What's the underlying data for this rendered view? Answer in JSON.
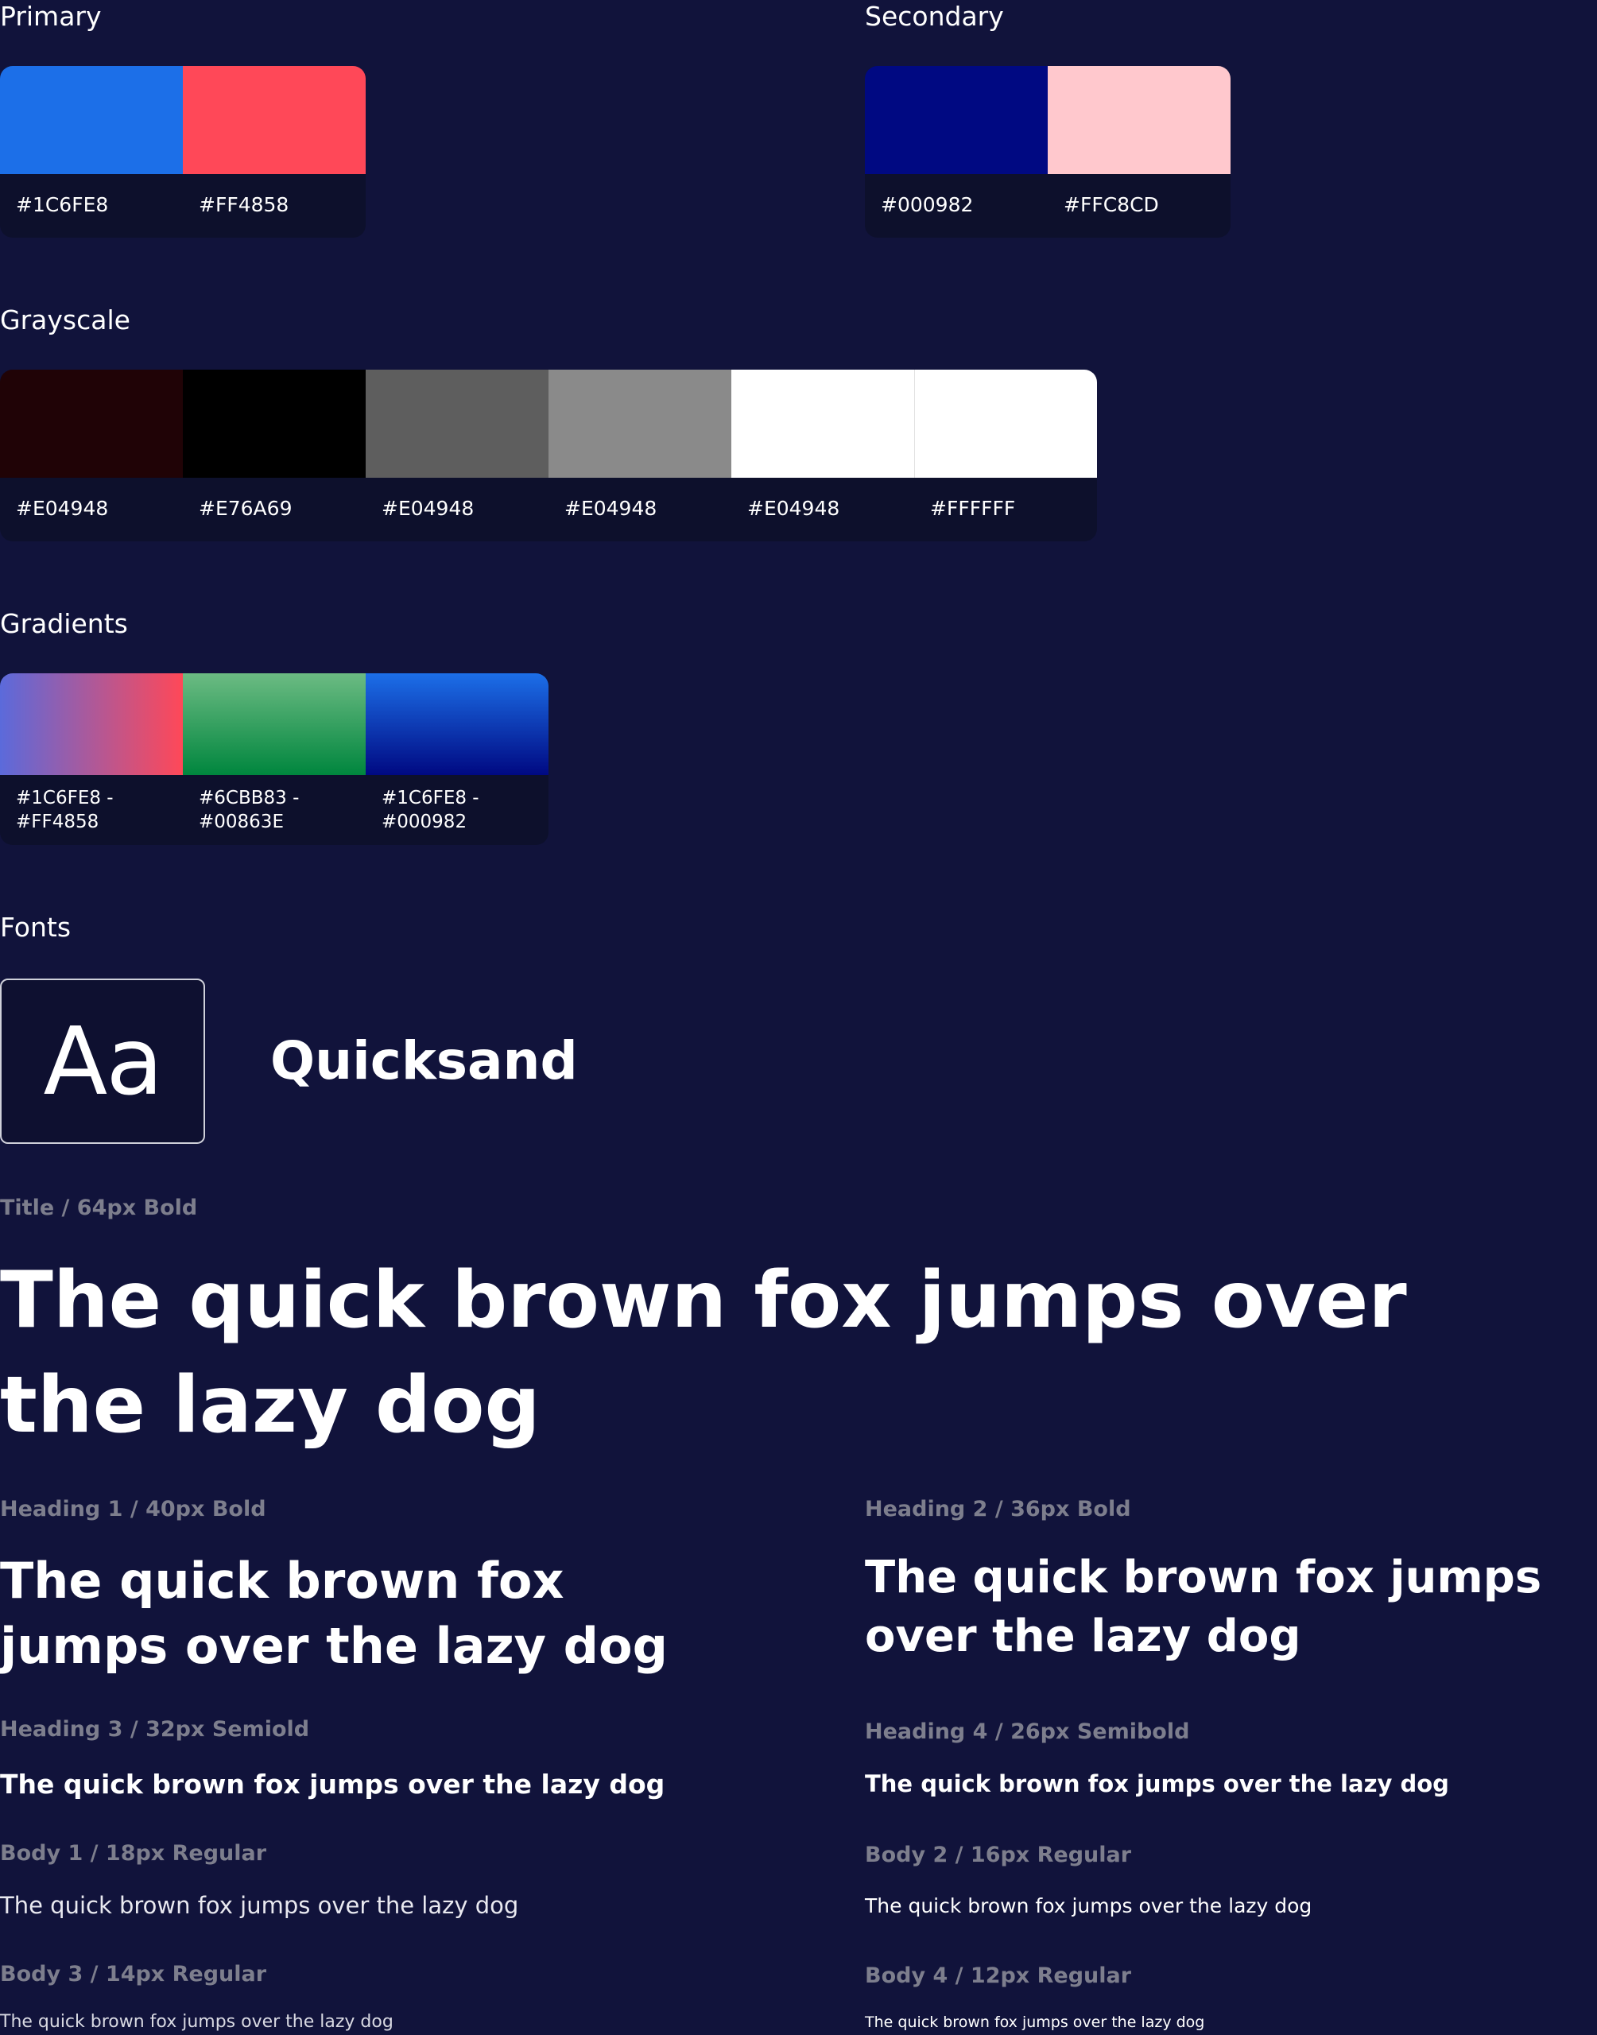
{
  "sections": {
    "primary": "Primary",
    "secondary": "Secondary",
    "grayscale": "Grayscale",
    "gradients": "Gradients",
    "fonts": "Fonts"
  },
  "colors": {
    "primary": [
      {
        "label": "#1C6FE8",
        "swatch": "#1C6FE8"
      },
      {
        "label": "#FF4858",
        "swatch": "#FF4858"
      }
    ],
    "secondary": [
      {
        "label": "#000982",
        "swatch": "#000982"
      },
      {
        "label": "#FFC8CD",
        "swatch": "#FFC8CD"
      }
    ],
    "grayscale": [
      {
        "label": "#E04948",
        "swatch": "#200306"
      },
      {
        "label": "#E76A69",
        "swatch": "#000000"
      },
      {
        "label": "#E04948",
        "swatch": "#5E5E5E"
      },
      {
        "label": "#E04948",
        "swatch": "#8A8A8A"
      },
      {
        "label": "#E04948",
        "swatch": "#FFFFFF"
      },
      {
        "label": "#FFFFFF",
        "swatch": "#FFFFFF"
      }
    ],
    "gradients": [
      {
        "label": "#1C6FE8 - #FF4858",
        "from": "#5B6ADB",
        "to": "#FF4858",
        "direction": "to right"
      },
      {
        "label": "#6CBB83 - #00863E",
        "from": "#6CBB83",
        "to": "#00863E",
        "direction": "to bottom"
      },
      {
        "label": "#1C6FE8 - #000982",
        "from": "#1C6FE8",
        "to": "#000982",
        "direction": "to bottom"
      }
    ]
  },
  "fonts": {
    "glyph": "Aa",
    "family_label": "Quicksand"
  },
  "typography": {
    "title": {
      "spec": "Title / 64px Bold",
      "sample": "The quick brown fox jumps over the lazy dog"
    },
    "h1": {
      "spec": "Heading 1 / 40px Bold",
      "sample": "The quick brown fox jumps over the lazy dog"
    },
    "h2": {
      "spec": "Heading 2 / 36px Bold",
      "sample": "The quick brown fox jumps over the lazy dog"
    },
    "h3": {
      "spec": "Heading 3 / 32px Semiold",
      "sample": "The quick brown fox jumps over the lazy dog"
    },
    "h4": {
      "spec": "Heading 4 / 26px Semibold",
      "sample": "The quick brown fox jumps over the lazy dog"
    },
    "b1": {
      "spec": "Body 1 / 18px Regular",
      "sample": "The quick brown fox jumps over the lazy dog"
    },
    "b2": {
      "spec": "Body 2 / 16px Regular",
      "sample": "The quick brown fox jumps over the lazy dog"
    },
    "b3": {
      "spec": "Body 3 / 14px Regular",
      "sample": "The quick brown fox jumps over the lazy dog"
    },
    "b4": {
      "spec": "Body 4 / 12px Regular",
      "sample": "The quick brown fox jumps over the lazy dog"
    }
  }
}
